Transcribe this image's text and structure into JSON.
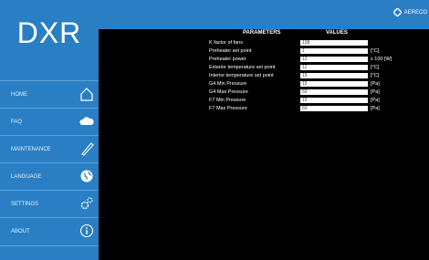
{
  "app": {
    "logo_text": "DXR",
    "brand": "AERECO"
  },
  "nav": [
    {
      "label": "HOME",
      "icon": "home-icon"
    },
    {
      "label": "FAQ",
      "icon": "cloud-icon"
    },
    {
      "label": "MAINTENANCE",
      "icon": "wrench-icon"
    },
    {
      "label": "LANGUAGE",
      "icon": "globe-icon"
    },
    {
      "label": "SETTINGS",
      "icon": "gears-icon"
    },
    {
      "label": "ABOUT",
      "icon": "info-icon"
    }
  ],
  "table": {
    "header_parameters": "PARAMETERS",
    "header_values": "VALUES",
    "rows": [
      {
        "label": "K factor of fans",
        "value": "108",
        "unit": ""
      },
      {
        "label": "Preheater set point",
        "value": "1",
        "unit": "[°C]"
      },
      {
        "label": "Preheater power",
        "value": "12",
        "unit": "x 100 [W]"
      },
      {
        "label": "Exterior temperature set point",
        "value": "12",
        "unit": "[°C]"
      },
      {
        "label": "Interior temperature set point",
        "value": "15",
        "unit": "[°C]"
      },
      {
        "label": "G4 Min Pressure",
        "value": "15",
        "unit": "[Pa]"
      },
      {
        "label": "G4 Max Pressure",
        "value": "50",
        "unit": "[Pa]"
      },
      {
        "label": "F7 Min Pressure",
        "value": "15",
        "unit": "[Pa]"
      },
      {
        "label": "F7 Max Pressure",
        "value": "60",
        "unit": "[Pa]"
      }
    ]
  },
  "colors": {
    "accent": "#2a7fc4",
    "background": "#000000",
    "field": "#ffffff"
  }
}
